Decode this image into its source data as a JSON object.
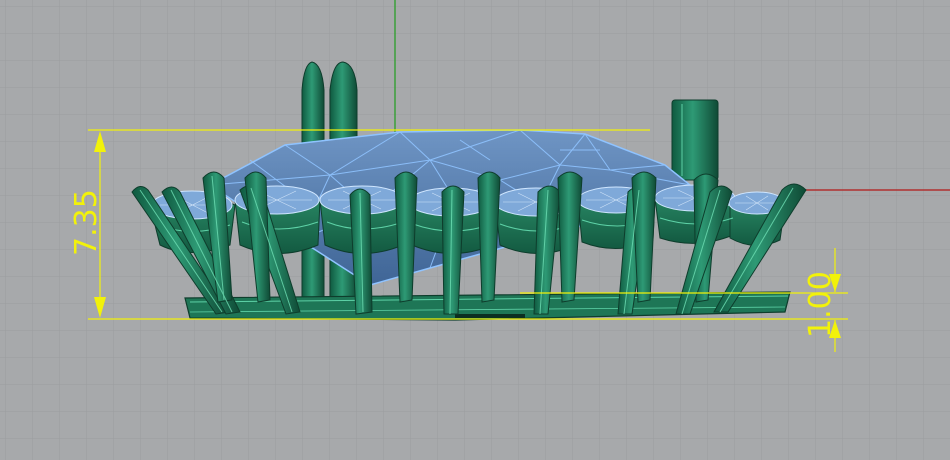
{
  "viewport": {
    "background": "#a7a9ab",
    "grid_color": "#9a9c9e",
    "x_axis_color": "#b03030",
    "y_axis_color": "#3aa03a"
  },
  "model": {
    "metal_color": "#1f7a5c",
    "metal_edge": "#0e3d2c",
    "gem_color": "#5a84b8",
    "gem_wire": "#8fc3ff"
  },
  "dimensions": {
    "height": {
      "label": "7.35",
      "color": "#f2f20a"
    },
    "base": {
      "label": "1.00",
      "color": "#f2f20a"
    }
  }
}
